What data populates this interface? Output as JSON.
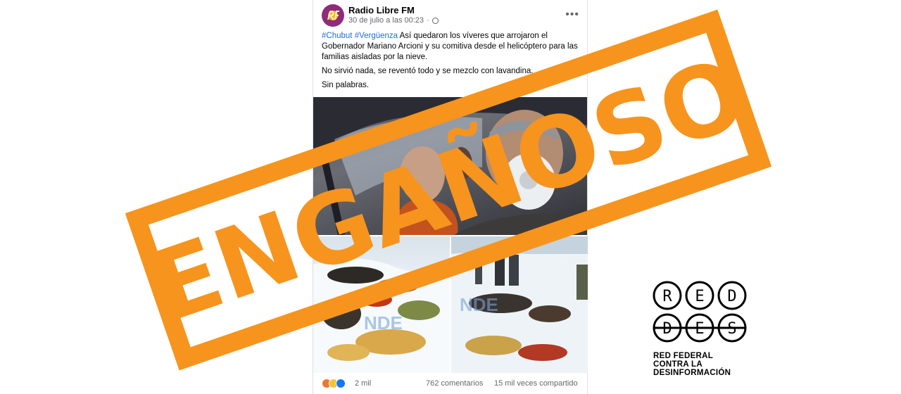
{
  "post": {
    "page_name": "Radio Libre FM",
    "timestamp": "30 de julio a las 00:23",
    "more_options": "•••",
    "hashtags": [
      "#Chubut",
      "#Vergüenza"
    ],
    "body_line1": " Así quedaron los víveres que arrojaron el Gobernador Mariano Arcioni y su comitiva desde el helicóptero para las familias aisladas por la nieve.",
    "body_line2": "No sirvió nada, se reventó todo y se mezclo con lavandina.",
    "body_line3": "Sin palabras.",
    "watermark": "NDE",
    "reactions_count": "2 mil",
    "comments_count": "762 comentarios",
    "shares_count": "15 mil veces compartido"
  },
  "stamp": {
    "label": "ENGAÑOSO",
    "color": "#f7941d"
  },
  "brand": {
    "logo_top": [
      "R",
      "E",
      "D"
    ],
    "logo_bottom": [
      "D",
      "E",
      "S"
    ],
    "caption": [
      "RED FEDERAL",
      "CONTRA LA",
      "DESINFORMACIÓN"
    ]
  },
  "icons": [
    "globe-icon",
    "more-icon",
    "angry-reaction-icon",
    "sad-reaction-icon",
    "like-reaction-icon"
  ],
  "colors": {
    "link": "#216fdb",
    "secondary_text": "#65676b",
    "stamp": "#f7941d"
  }
}
